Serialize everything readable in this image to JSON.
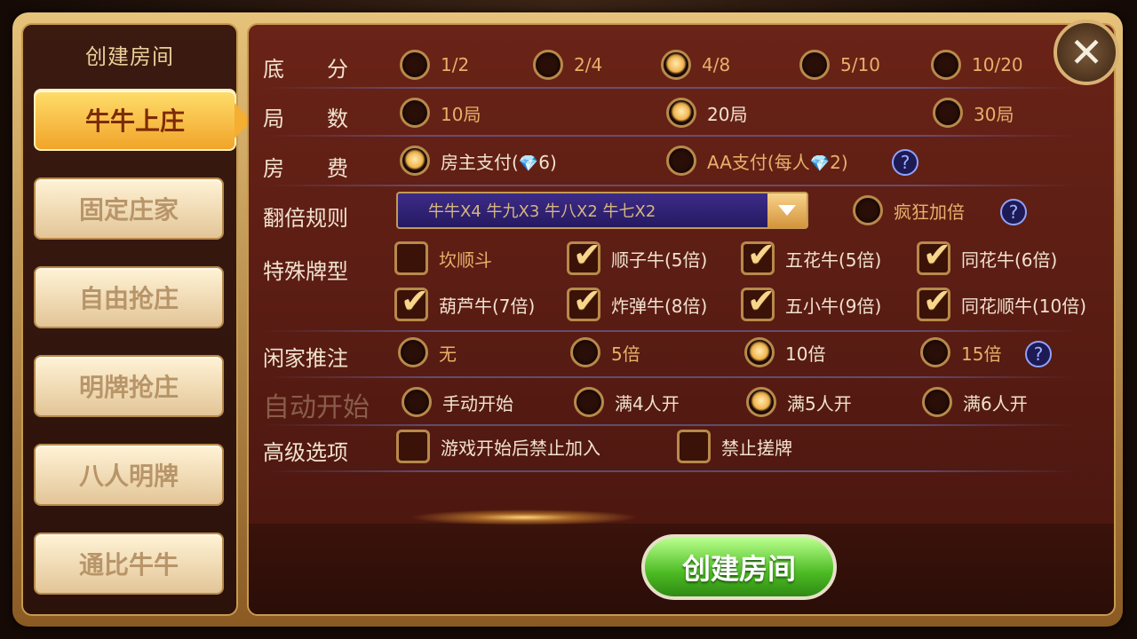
{
  "sidebar": {
    "title": "创建房间",
    "items": [
      {
        "label": "牛牛上庄",
        "active": true
      },
      {
        "label": "固定庄家",
        "active": false
      },
      {
        "label": "自由抢庄",
        "active": false
      },
      {
        "label": "明牌抢庄",
        "active": false
      },
      {
        "label": "八人明牌",
        "active": false
      },
      {
        "label": "通比牛牛",
        "active": false
      }
    ]
  },
  "form": {
    "base_score": {
      "label": "底　　分",
      "options": [
        "1/2",
        "2/4",
        "4/8",
        "5/10",
        "10/20"
      ],
      "selected": "4/8"
    },
    "rounds": {
      "label": "局　　数",
      "options": [
        "10局",
        "20局",
        "30局"
      ],
      "selected": "20局"
    },
    "room_fee": {
      "label": "房　　费",
      "owner_prefix": "房主支付(",
      "owner_value": "6)",
      "aa_prefix": "AA支付(每人",
      "aa_value": "2)",
      "selected": "房主支付"
    },
    "multiplier": {
      "label": "翻倍规则",
      "value": "牛牛X4  牛九X3  牛八X2  牛七X2",
      "crazy_label": "疯狂加倍",
      "crazy_checked": false
    },
    "special": {
      "label": "特殊牌型",
      "items": [
        {
          "label": "坎顺斗",
          "checked": false
        },
        {
          "label": "顺子牛(5倍)",
          "checked": true
        },
        {
          "label": "五花牛(5倍)",
          "checked": true
        },
        {
          "label": "同花牛(6倍)",
          "checked": true
        },
        {
          "label": "葫芦牛(7倍)",
          "checked": true
        },
        {
          "label": "炸弹牛(8倍)",
          "checked": true
        },
        {
          "label": "五小牛(9倍)",
          "checked": true
        },
        {
          "label": "同花顺牛(10倍)",
          "checked": true
        }
      ]
    },
    "push_bet": {
      "label": "闲家推注",
      "options": [
        "无",
        "5倍",
        "10倍",
        "15倍"
      ],
      "selected": "10倍"
    },
    "auto_start": {
      "label": "自动开始",
      "options": [
        "手动开始",
        "满4人开",
        "满5人开",
        "满6人开"
      ],
      "selected": "满5人开"
    },
    "advanced": {
      "label": "高级选项",
      "options": [
        "游戏开始后禁止加入",
        "禁止搓牌"
      ]
    }
  },
  "buttons": {
    "create": "创建房间",
    "close": "✕"
  },
  "help_glyph": "?",
  "colors": {
    "accent_gold": "#f2b34a",
    "create_green": "#4cbb23",
    "panel": "#5a2514"
  }
}
